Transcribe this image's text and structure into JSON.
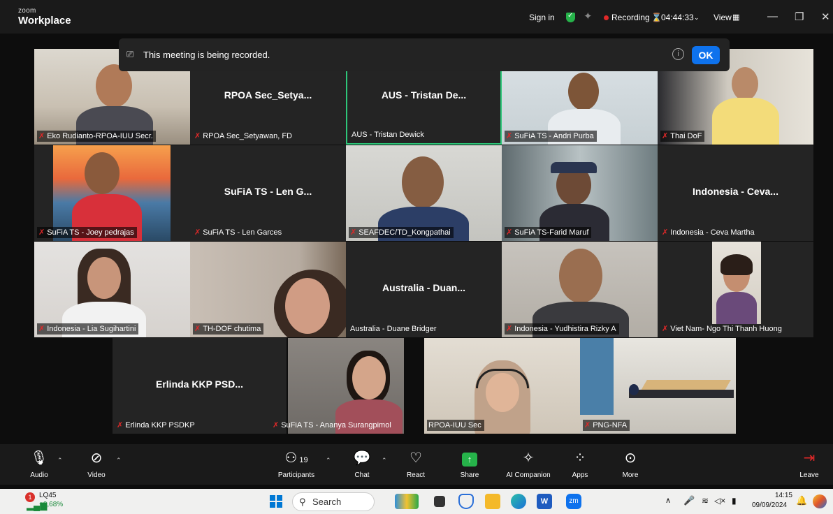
{
  "app": {
    "brand_small": "zoom",
    "brand_big": "Workplace"
  },
  "titlebar": {
    "sign_in": "Sign in",
    "recording": "Recording",
    "timer": "04:44:33",
    "view": "View"
  },
  "banner": {
    "text": "This meeting is being recorded.",
    "ok": "OK"
  },
  "tiles": [
    {
      "label": "Eko Rudianto-RPOA-IUU Secr.",
      "big": "",
      "muted": true
    },
    {
      "label": "RPOA Sec_Setyawan, FD",
      "big": "RPOA Sec_Setya...",
      "muted": true
    },
    {
      "label": "AUS - Tristan Dewick",
      "big": "AUS - Tristan De...",
      "muted": false
    },
    {
      "label": "SuFiA TS - Andri Purba",
      "big": "",
      "muted": true
    },
    {
      "label": "Thai DoF",
      "big": "",
      "muted": true
    },
    {
      "label": "SuFiA TS - Joey pedrajas",
      "big": "",
      "muted": true
    },
    {
      "label": "SuFiA TS - Len Garces",
      "big": "SuFiA TS - Len G...",
      "muted": true
    },
    {
      "label": "SEAFDEC/TD_Kongpathai",
      "big": "",
      "muted": true
    },
    {
      "label": "SuFiA TS-Farid Maruf",
      "big": "",
      "muted": true
    },
    {
      "label": "Indonesia - Ceva Martha",
      "big": "Indonesia - Ceva...",
      "muted": true
    },
    {
      "label": "Indonesia - Lia Sugihartini",
      "big": "",
      "muted": true
    },
    {
      "label": "TH-DOF chutima",
      "big": "",
      "muted": true
    },
    {
      "label": "Australia - Duane Bridger",
      "big": "Australia - Duan...",
      "muted": false
    },
    {
      "label": "Indonesia - Yudhistira Rizky A",
      "big": "",
      "muted": true
    },
    {
      "label": "Viet Nam- Ngo Thi Thanh Huong",
      "big": "",
      "muted": true
    },
    {
      "label": "Erlinda KKP PSDKP",
      "big": "Erlinda KKP PSD...",
      "muted": true
    },
    {
      "label": "SuFiA TS - Ananya Surangpimol",
      "big": "",
      "muted": true
    },
    {
      "label": "RPOA-IUU Sec",
      "big": "",
      "muted": false
    },
    {
      "label": "PNG-NFA",
      "big": "",
      "muted": true
    }
  ],
  "toolbar": {
    "audio": "Audio",
    "video": "Video",
    "participants": "Participants",
    "participants_count": "19",
    "chat": "Chat",
    "react": "React",
    "share": "Share",
    "ai": "AI Companion",
    "apps": "Apps",
    "more": "More",
    "leave": "Leave"
  },
  "taskbar": {
    "stock_name": "LQ45",
    "stock_change": "+0,68%",
    "stock_badge": "1",
    "search": "Search",
    "zoom_app": "zm",
    "time": "14:15",
    "date": "09/09/2024"
  },
  "colors": {
    "accent": "#0e72ed",
    "record": "#e02828",
    "active_speaker": "#2ec77a"
  }
}
